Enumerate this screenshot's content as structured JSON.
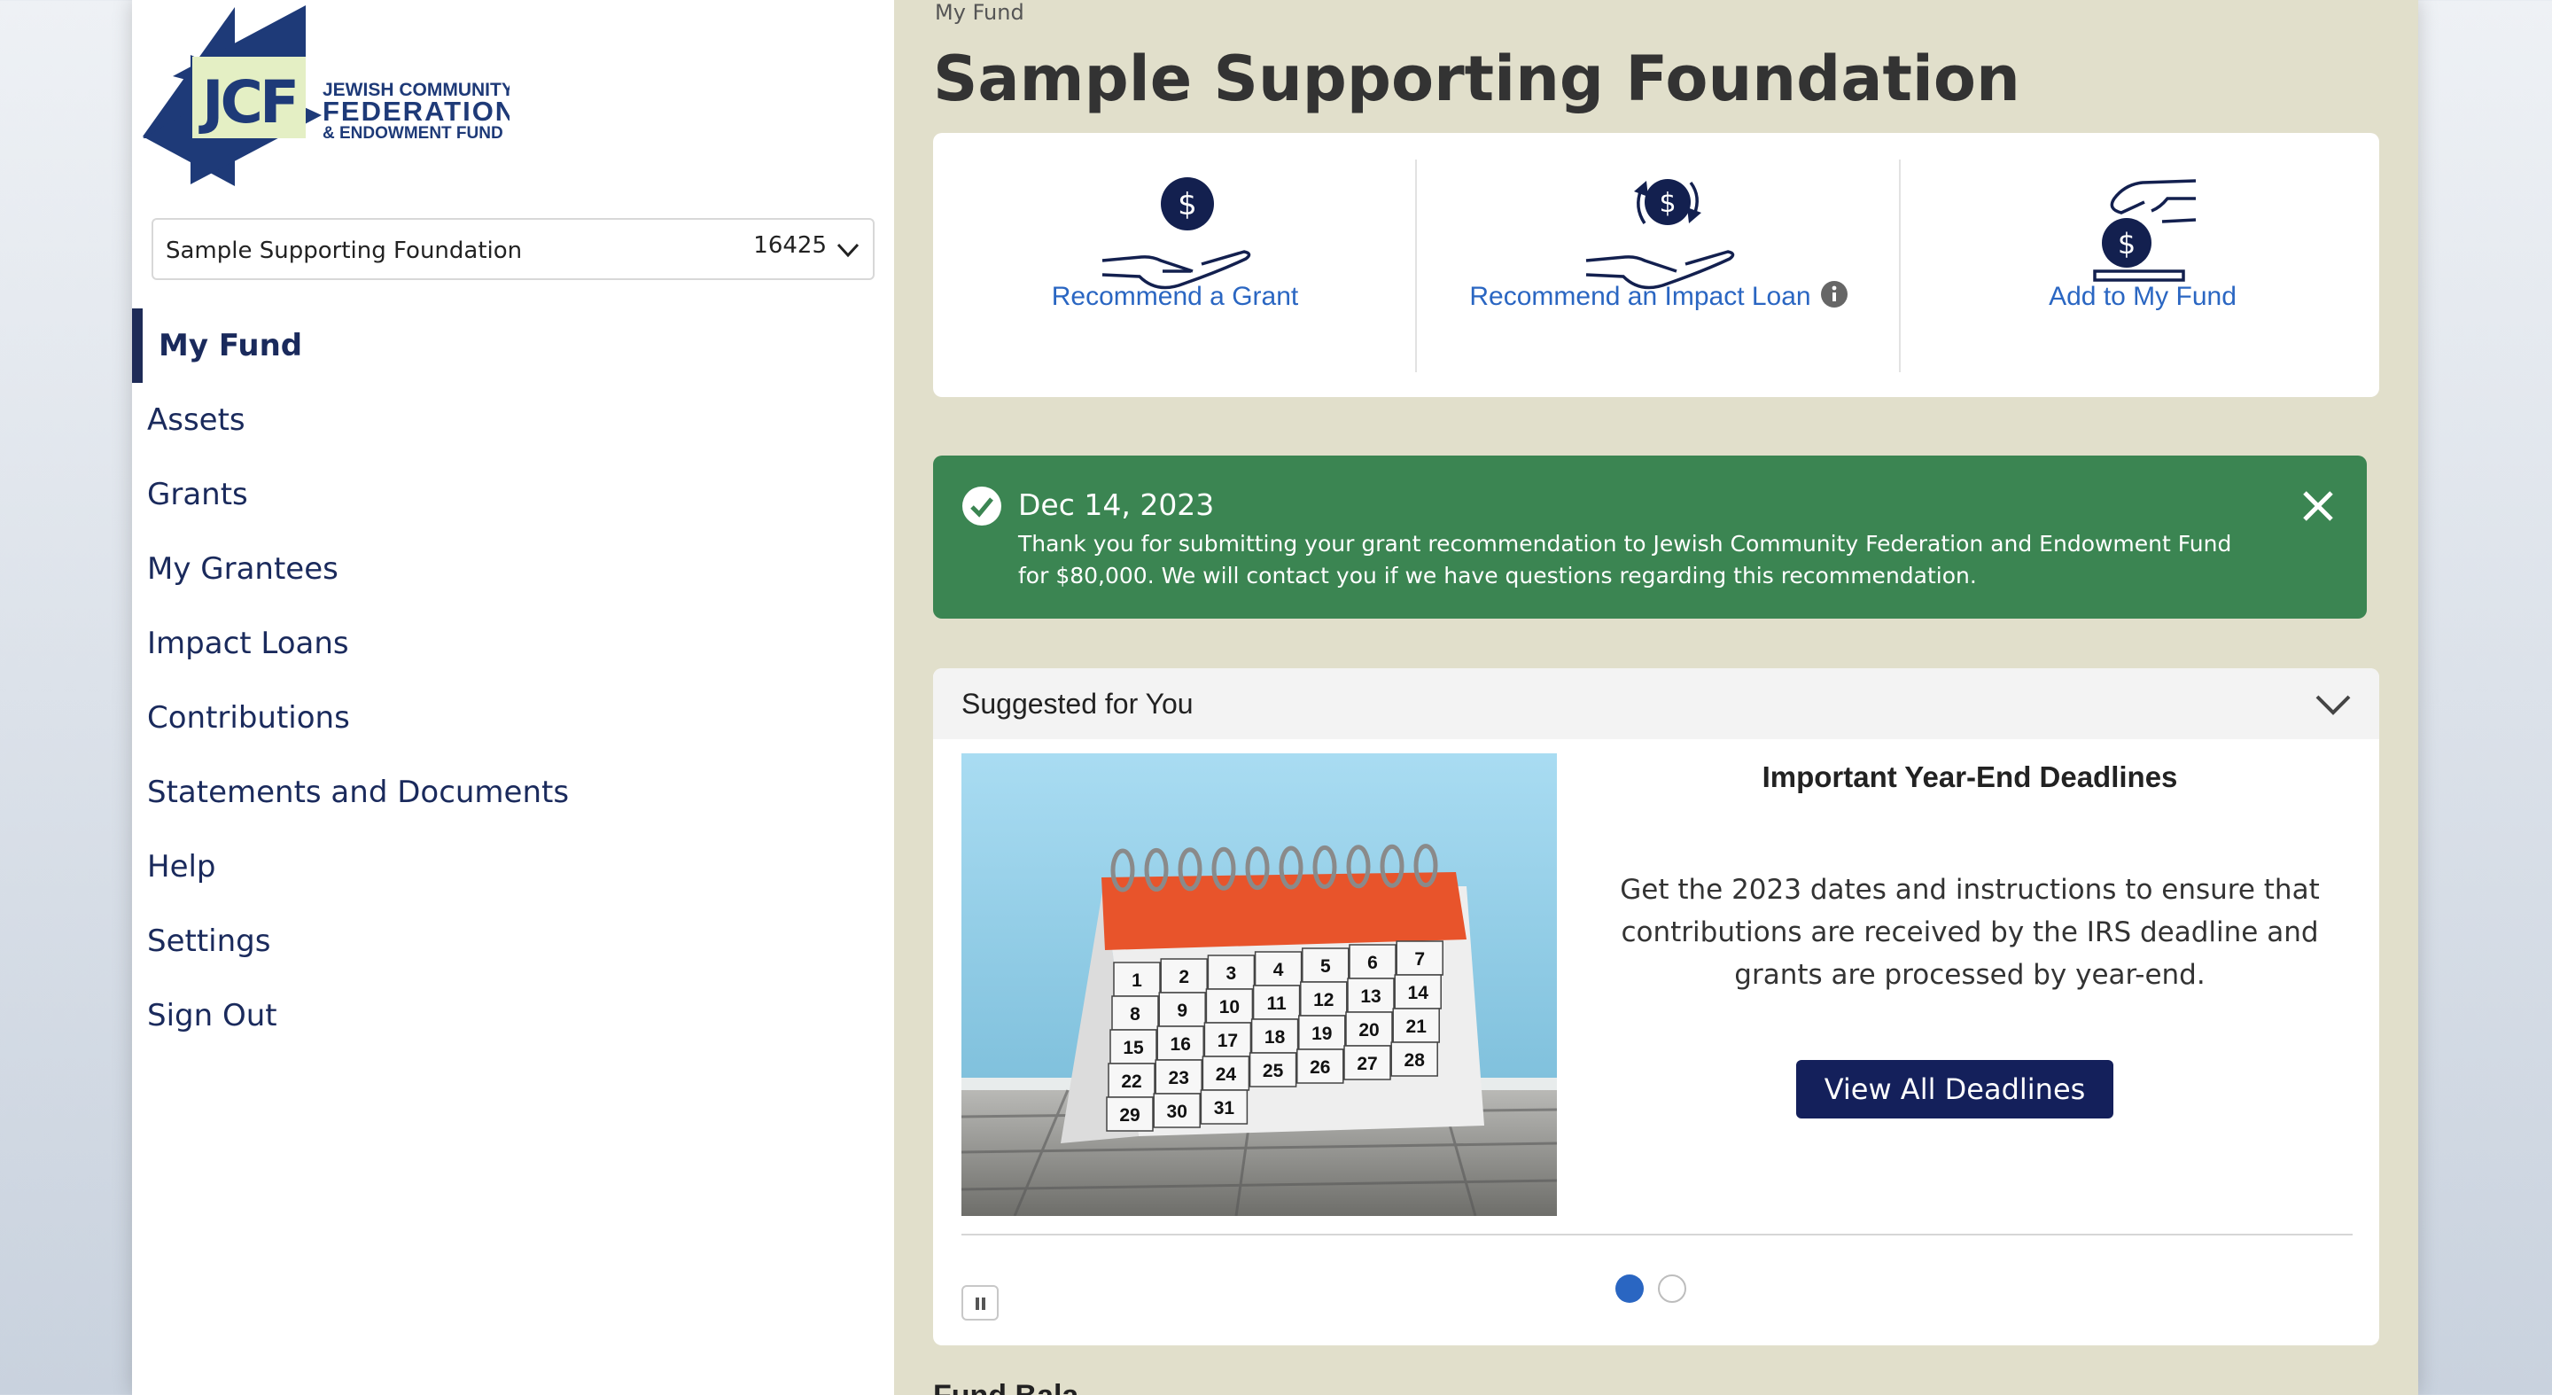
{
  "sidebar": {
    "logo": {
      "letters": "JCF",
      "line1": "JEWISH COMMUNITY",
      "line2": "FEDERATION",
      "line3": "& ENDOWMENT FUND"
    },
    "fund_selector": {
      "name": "Sample Supporting Foundation",
      "number": "16425"
    },
    "nav": [
      {
        "label": "My Fund",
        "active": true
      },
      {
        "label": "Assets"
      },
      {
        "label": "Grants"
      },
      {
        "label": "My Grantees"
      },
      {
        "label": "Impact Loans"
      },
      {
        "label": "Contributions"
      },
      {
        "label": "Statements and Documents"
      },
      {
        "label": "Help"
      },
      {
        "label": "Settings"
      },
      {
        "label": "Sign Out"
      }
    ]
  },
  "main": {
    "breadcrumb": "My Fund",
    "title": "Sample Supporting Foundation",
    "actions": [
      {
        "label": "Recommend a Grant",
        "icon": "hand-coin-icon"
      },
      {
        "label": "Recommend an Impact Loan",
        "icon": "hand-coin-cycle-icon"
      },
      {
        "label": "Add to My Fund",
        "icon": "hand-deposit-coin-icon"
      }
    ],
    "alert": {
      "date": "Dec 14, 2023",
      "message": "Thank you for submitting your grant recommendation to Jewish Community Federation and Endowment Fund for $80,000. We will contact you if we have questions regarding this recommendation."
    },
    "suggested": {
      "header": "Suggested for You",
      "card": {
        "title": "Important Year-End Deadlines",
        "body": "Get the 2023 dates and instructions to ensure that contributions are received by the IRS deadline and grants are processed by year-end.",
        "button": "View All Deadlines"
      },
      "calendar_days": [
        "1",
        "2",
        "3",
        "4",
        "5",
        "6",
        "7",
        "8",
        "9",
        "10",
        "11",
        "12",
        "13",
        "14",
        "15",
        "16",
        "17",
        "18",
        "19",
        "20",
        "21",
        "22",
        "23",
        "24",
        "25",
        "26",
        "27",
        "28",
        "29",
        "30",
        "31"
      ],
      "carousel_pages": 2,
      "carousel_current": 1
    },
    "peek_heading": "Fund Bala"
  },
  "colors": {
    "navy": "#1e2b57",
    "link_blue": "#2a66c2",
    "success_green": "#3b8552",
    "page_bg": "#e1dfcb",
    "logo_green": "#e4efc4"
  }
}
